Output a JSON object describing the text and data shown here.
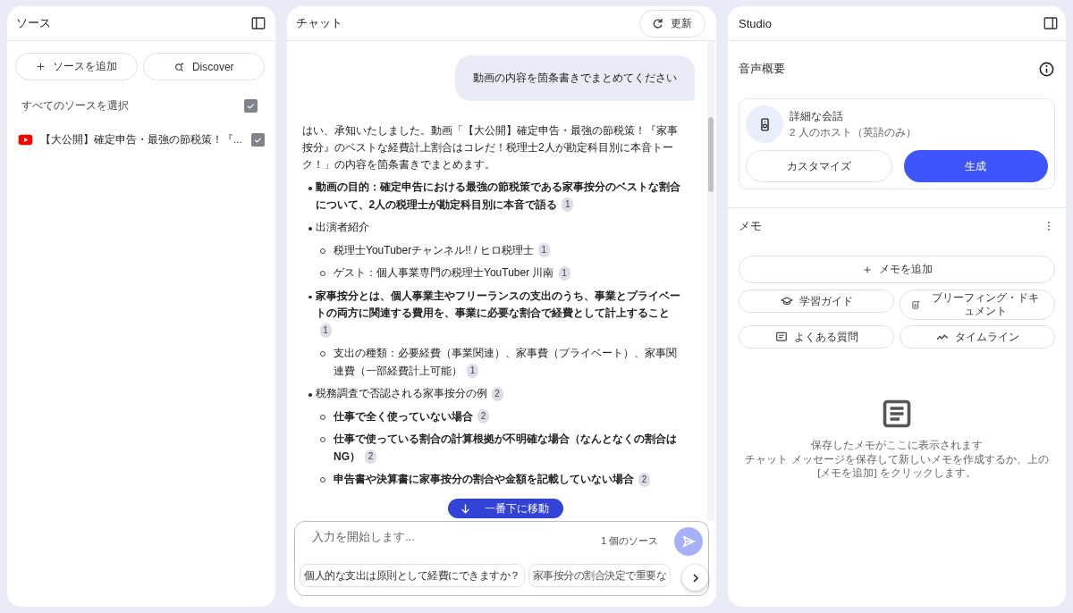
{
  "sources": {
    "title": "ソース",
    "add_button": "ソースを追加",
    "discover_button": "Discover",
    "select_all": {
      "label": "すべてのソースを選択",
      "checked": true
    },
    "items": [
      {
        "title": "【大公開】確定申告・最強の節税策！『...",
        "checked": true
      }
    ]
  },
  "chat": {
    "title": "チャット",
    "refresh_button": "更新",
    "user_message": "動画の内容を箇条書きでまとめてください",
    "intro": "はい、承知いたしました。動画「【大公開】確定申告・最強の節税策！『家事按分』のベストな経費計上割合はコレだ！税理士2人が勘定科目別に本音トーク！」の内容を箇条書きでまとめます。",
    "items": [
      {
        "text": "動画の目的：確定申告における最強の節税策である家事按分のベストな割合について、2人の税理士が勘定科目別に本音で語る",
        "bold": true,
        "citation": "1"
      },
      {
        "text": "出演者紹介",
        "bold": false,
        "children": [
          {
            "text": "税理士YouTuberチャンネル!! / ヒロ税理士",
            "bold": false,
            "citation": "1"
          },
          {
            "text": "ゲスト：個人事業専門の税理士YouTuber 川南",
            "bold": false,
            "citation": "1"
          }
        ]
      },
      {
        "text": "家事按分とは、個人事業主やフリーランスの支出のうち、事業とプライベートの両方に関連する費用を、事業に必要な割合で経費として計上すること",
        "bold": true,
        "citation": "1",
        "children": [
          {
            "text": "支出の種類：必要経費（事業関連）、家事費（プライベート）、家事関連費（一部経費計上可能）",
            "bold": false,
            "citation": "1"
          }
        ]
      },
      {
        "text": "税務調査で否認される家事按分の例",
        "bold": false,
        "citation": "2",
        "children": [
          {
            "text": "仕事で全く使っていない場合",
            "bold": true,
            "citation": "2"
          },
          {
            "text": "仕事で使っている割合の計算根拠が不明確な場合（なんとなくの割合はNG）",
            "bold": true,
            "citation": "2"
          },
          {
            "text": "申告書や決算書に家事按分の割合や金額を記載していない場合",
            "bold": true,
            "citation": "2"
          }
        ]
      }
    ],
    "jump_button": "一番下に移動",
    "input": {
      "placeholder": "入力を開始します...",
      "source_count": "1 個のソース"
    },
    "suggestions": [
      "個人的な支出は原則として経費にできますか？",
      "家事按分の割合決定で重要な"
    ]
  },
  "studio": {
    "title": "Studio",
    "audio": {
      "title": "音声概要",
      "card_title": "詳細な会話",
      "card_subtitle": "2 人のホスト（英語のみ）",
      "customize_button": "カスタマイズ",
      "generate_button": "生成"
    },
    "notes": {
      "title": "メモ",
      "add_button": "メモを追加",
      "tools": [
        {
          "label": "学習ガイド",
          "kind": "guide"
        },
        {
          "label": "ブリーフィング・ドキュメント",
          "kind": "briefing"
        },
        {
          "label": "よくある質問",
          "kind": "faq"
        },
        {
          "label": "タイムライン",
          "kind": "timeline"
        }
      ],
      "empty_title": "保存したメモがここに表示されます",
      "empty_message": "チャット メッセージを保存して新しいメモを作成するか、上の [メモを追加] をクリックします。"
    }
  }
}
